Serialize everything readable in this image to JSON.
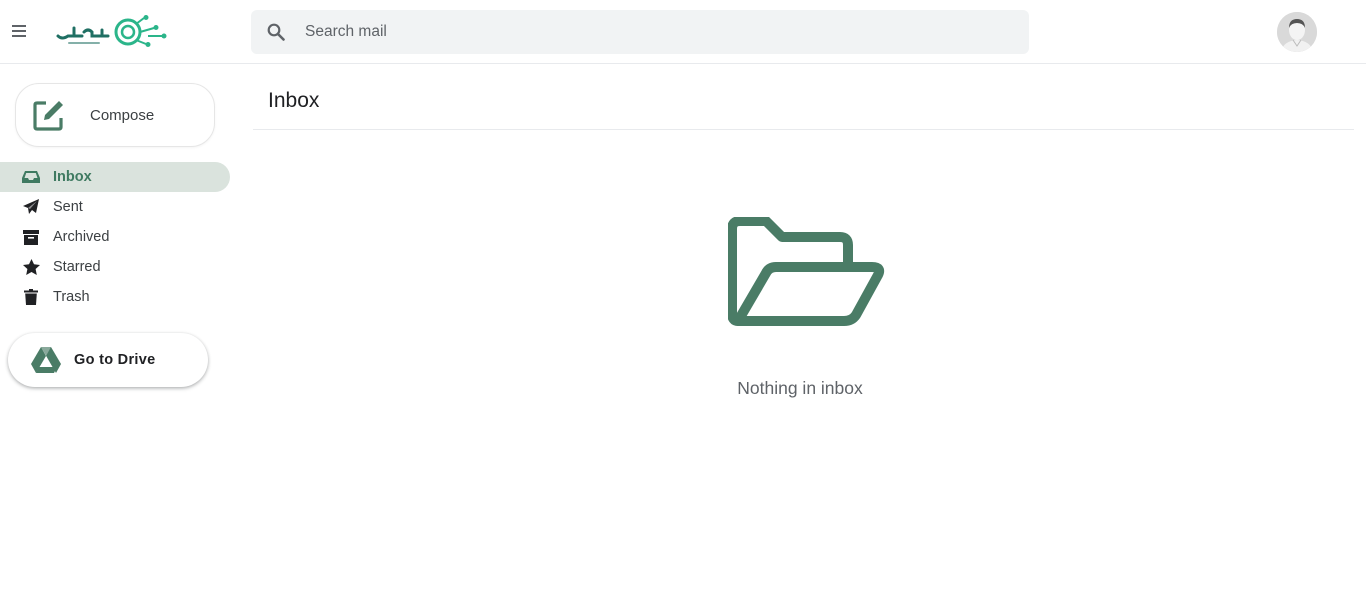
{
  "header": {
    "search": {
      "placeholder": "Search mail",
      "value": ""
    }
  },
  "sidebar": {
    "compose_label": "Compose",
    "items": [
      {
        "label": "Inbox",
        "icon": "inbox-icon",
        "active": true
      },
      {
        "label": "Sent",
        "icon": "paper-plane-icon",
        "active": false
      },
      {
        "label": "Archived",
        "icon": "archive-box-icon",
        "active": false
      },
      {
        "label": "Starred",
        "icon": "star-icon",
        "active": false
      },
      {
        "label": "Trash",
        "icon": "trash-icon",
        "active": false
      }
    ],
    "drive_label": "Go to Drive"
  },
  "main": {
    "title": "Inbox",
    "empty_message": "Nothing in inbox"
  },
  "colors": {
    "accent": "#4a7c66",
    "active_bg": "#dae3dd",
    "search_bg": "#f1f3f4"
  }
}
